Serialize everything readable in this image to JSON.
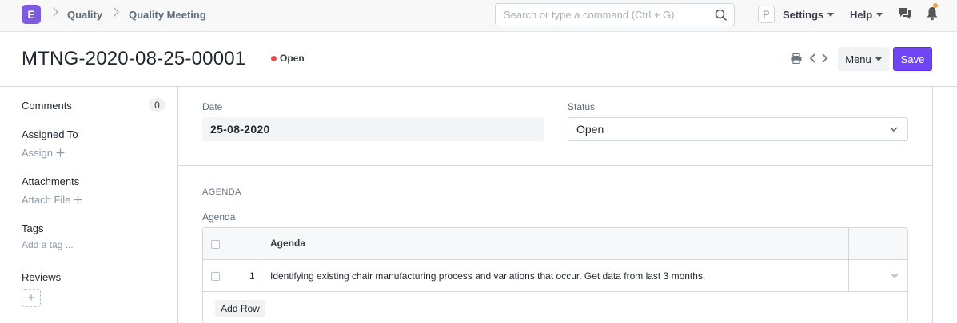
{
  "navbar": {
    "logo_letter": "E",
    "breadcrumbs": [
      "Quality",
      "Quality Meeting"
    ],
    "search_placeholder": "Search or type a command (Ctrl + G)",
    "avatar_letter": "P",
    "settings_label": "Settings",
    "help_label": "Help",
    "notification_dot_color": "#f2a03b"
  },
  "page": {
    "title": "MTNG-2020-08-25-00001",
    "status": "Open",
    "status_color": "#e24c4c",
    "menu_label": "Menu",
    "save_label": "Save",
    "accent_color": "#6f45f5"
  },
  "sidebar": {
    "comments_label": "Comments",
    "comments_count": "0",
    "assigned_to_label": "Assigned To",
    "assign_action": "Assign",
    "attachments_label": "Attachments",
    "attach_action": "Attach File",
    "tags_label": "Tags",
    "add_tag_action": "Add a tag ...",
    "reviews_label": "Reviews",
    "add_review_symbol": "+"
  },
  "form": {
    "date_label": "Date",
    "date_value": "25-08-2020",
    "status_label": "Status",
    "status_value": "Open",
    "agenda_section_title": "AGENDA",
    "agenda_field_label": "Agenda",
    "agenda_grid": {
      "column_header": "Agenda",
      "rows": [
        {
          "idx": "1",
          "agenda": "Identifying existing chair manufacturing process and variations that occur. Get data from last 3 months."
        }
      ],
      "add_row_label": "Add Row"
    }
  }
}
